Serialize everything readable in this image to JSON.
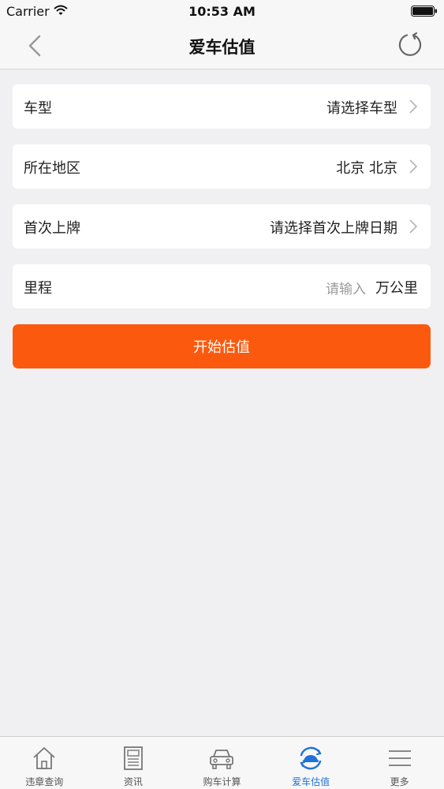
{
  "status_bar": {
    "carrier": "Carrier",
    "time": "10:53 AM"
  },
  "nav": {
    "title": "爱车估值"
  },
  "form": {
    "model": {
      "label": "车型",
      "value": "请选择车型"
    },
    "region": {
      "label": "所在地区",
      "value": "北京 北京"
    },
    "first_registration": {
      "label": "首次上牌",
      "value": "请选择首次上牌日期"
    },
    "mileage": {
      "label": "里程",
      "placeholder": "请输入",
      "unit": "万公里"
    }
  },
  "start_button_label": "开始估值",
  "tabs": [
    {
      "label": "违章查询",
      "icon": "home-icon"
    },
    {
      "label": "资讯",
      "icon": "news-icon"
    },
    {
      "label": "购车计算",
      "icon": "car-icon"
    },
    {
      "label": "爱车估值",
      "icon": "car-valuation-icon",
      "active": true
    },
    {
      "label": "更多",
      "icon": "menu-icon"
    }
  ],
  "colors": {
    "accent": "#fb5a0e",
    "active_tab": "#1f72d8"
  }
}
